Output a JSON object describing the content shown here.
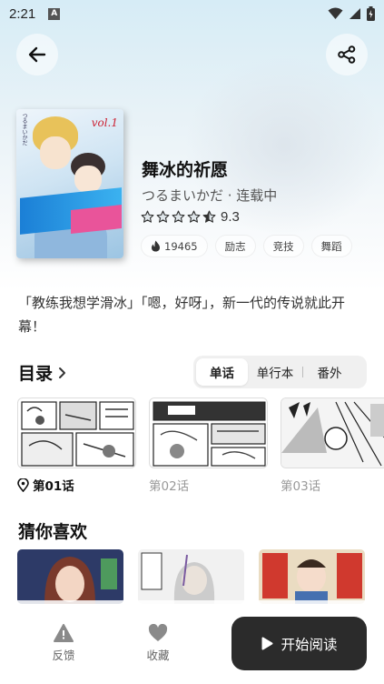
{
  "status_bar": {
    "time": "2:21",
    "badge": "A"
  },
  "manga": {
    "title": "舞冰的祈愿",
    "author_line": "つるまいかだ · 连载中",
    "rating": "9.3",
    "stars_filled": 4.5,
    "heat": "19465",
    "tags": [
      "励志",
      "竞技",
      "舞蹈"
    ],
    "summary": "「教练我想学滑冰」「嗯，好呀」，新一代的传说就此开幕！",
    "cover": {
      "vertical_text": "つるまいかだ",
      "vol": "vol.1"
    }
  },
  "catalog": {
    "title": "目录",
    "tabs": [
      {
        "label": "单话",
        "active": true
      },
      {
        "label": "单行本",
        "active": false
      },
      {
        "label": "番外",
        "active": false
      }
    ],
    "chapters": [
      {
        "label": "第01话",
        "current": true
      },
      {
        "label": "第02话",
        "current": false
      },
      {
        "label": "第03话",
        "current": false
      }
    ]
  },
  "recommend": {
    "title": "猜你喜欢"
  },
  "bottom_bar": {
    "feedback": "反馈",
    "favorite": "收藏",
    "read": "开始阅读"
  },
  "colors": {
    "accent_dark": "#2b2b2b",
    "hero_bg": "#d6ecf6"
  }
}
